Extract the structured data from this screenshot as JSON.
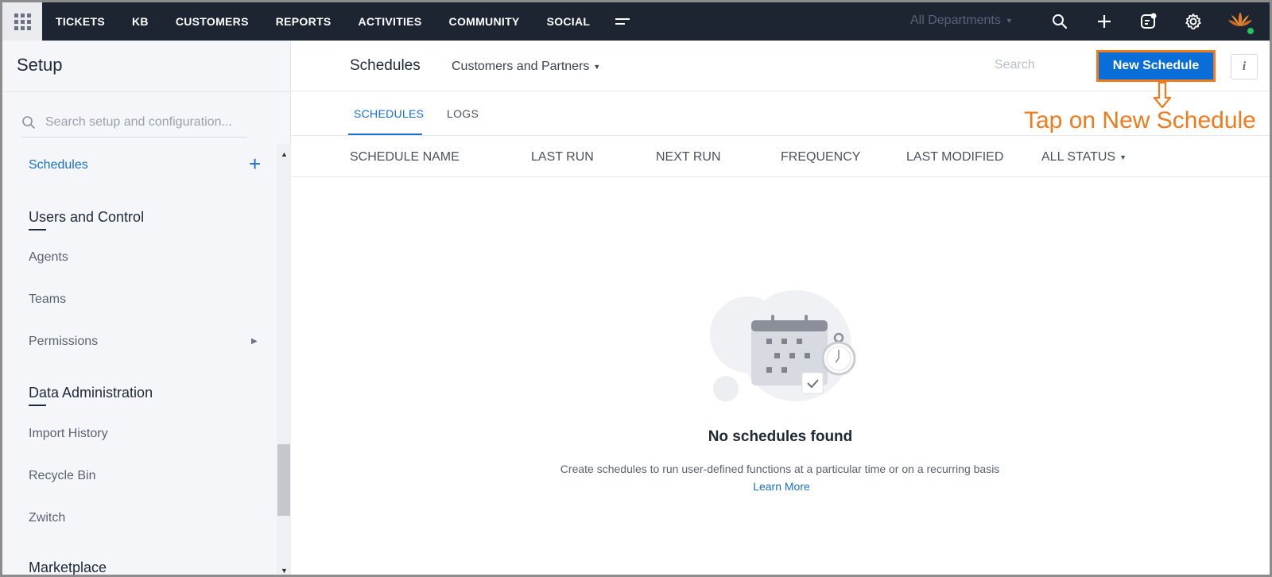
{
  "topbar": {
    "nav": [
      "TICKETS",
      "KB",
      "CUSTOMERS",
      "REPORTS",
      "ACTIVITIES",
      "COMMUNITY",
      "SOCIAL"
    ],
    "department_selector": "All Departments",
    "icons": [
      "apps-grid-icon",
      "more-menu-icon",
      "search-icon",
      "plus-icon",
      "chat-icon",
      "gear-icon",
      "avatar"
    ]
  },
  "sidebar": {
    "title": "Setup",
    "search_placeholder": "Search setup and configuration...",
    "active_item": "Schedules",
    "sections": [
      {
        "heading": "Users and Control",
        "items": [
          "Agents",
          "Teams",
          "Permissions"
        ]
      },
      {
        "heading": "Data Administration",
        "items": [
          "Import History",
          "Recycle Bin",
          "Zwitch"
        ]
      }
    ],
    "partial_heading": "Marketplace"
  },
  "main": {
    "title": "Schedules",
    "filter": "Customers and Partners",
    "search_placeholder": "Search",
    "new_button": "New Schedule",
    "info_button": "i",
    "tabs": [
      "SCHEDULES",
      "LOGS"
    ],
    "active_tab": "SCHEDULES",
    "columns": [
      "SCHEDULE NAME",
      "LAST RUN",
      "NEXT RUN",
      "FREQUENCY",
      "LAST MODIFIED",
      "ALL STATUS"
    ],
    "empty": {
      "title": "No schedules found",
      "description": "Create schedules to run user-defined functions at a particular time or on a recurring basis",
      "link": "Learn More"
    }
  },
  "annotation": {
    "text": "Tap on New Schedule",
    "color": "#f07a1c"
  },
  "colors": {
    "topbar": "#1d2533",
    "accent": "#1a6fd1",
    "primary_button": "#0a6ed8",
    "annotation": "#f07a1c"
  }
}
